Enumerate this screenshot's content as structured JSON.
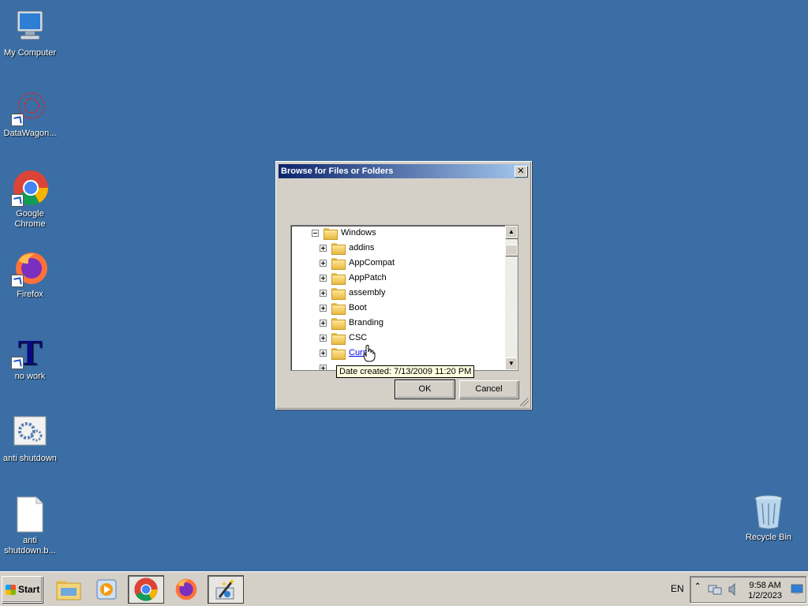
{
  "desktop": {
    "icons": [
      {
        "label": "My Computer"
      },
      {
        "label": "DataWagon..."
      },
      {
        "label": "Google Chrome"
      },
      {
        "label": "Firefox"
      },
      {
        "label": "no work"
      },
      {
        "label": "anti shutdown"
      },
      {
        "label": "anti\nshutdown.b..."
      },
      {
        "label": "Recycle Bin"
      }
    ]
  },
  "dialog": {
    "title": "Browse for Files or Folders",
    "close_label": "✕",
    "tree": {
      "root": "Windows",
      "children": [
        "addins",
        "AppCompat",
        "AppPatch",
        "assembly",
        "Boot",
        "Branding",
        "CSC",
        "Curs"
      ]
    },
    "ok_label": "OK",
    "cancel_label": "Cancel"
  },
  "tooltip": "Date created: 7/13/2009 11:20 PM",
  "taskbar": {
    "start_label": "Start",
    "language": "EN",
    "time": "9:58 AM",
    "date": "1/2/2023"
  }
}
